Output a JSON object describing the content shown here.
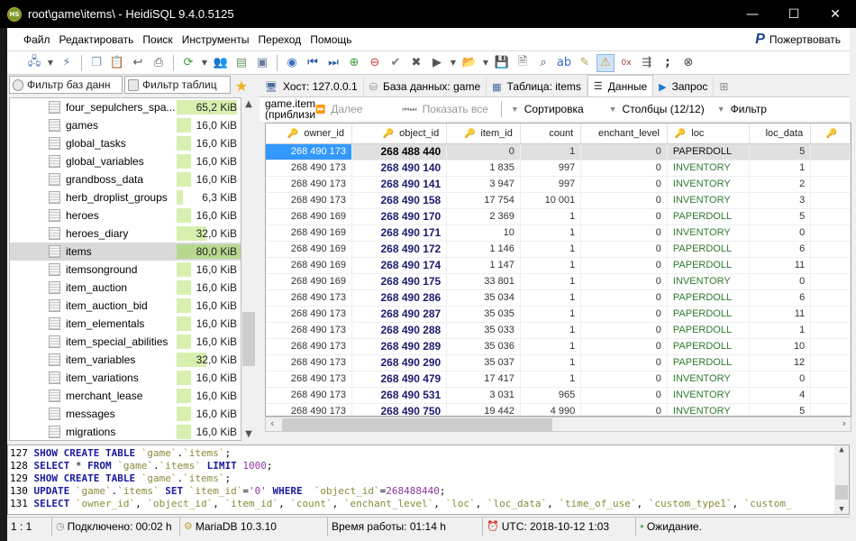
{
  "window": {
    "title": "root\\game\\items\\ - HeidiSQL 9.4.0.5125",
    "app_icon_label": "HS",
    "minimize": "—",
    "maximize": "☐",
    "close": "✕"
  },
  "menu": {
    "items": [
      "Файл",
      "Редактировать",
      "Поиск",
      "Инструменты",
      "Переход",
      "Помощь"
    ],
    "donate_label": "Пожертвовать"
  },
  "sidebar": {
    "filter_db_placeholder": "Фильтр баз данн",
    "filter_tables_placeholder": "Фильтр таблиц",
    "tables": [
      {
        "name": "four_sepulchers_spa...",
        "size": "65,2 KiB",
        "fill": 0.82
      },
      {
        "name": "games",
        "size": "16,0 KiB",
        "fill": 0.2
      },
      {
        "name": "global_tasks",
        "size": "16,0 KiB",
        "fill": 0.2
      },
      {
        "name": "global_variables",
        "size": "16,0 KiB",
        "fill": 0.2
      },
      {
        "name": "grandboss_data",
        "size": "16,0 KiB",
        "fill": 0.2
      },
      {
        "name": "herb_droplist_groups",
        "size": "6,3 KiB",
        "fill": 0.08
      },
      {
        "name": "heroes",
        "size": "16,0 KiB",
        "fill": 0.2
      },
      {
        "name": "heroes_diary",
        "size": "32,0 KiB",
        "fill": 0.4
      },
      {
        "name": "items",
        "size": "80,0 KiB",
        "fill": 1.0,
        "selected": true
      },
      {
        "name": "itemsonground",
        "size": "16,0 KiB",
        "fill": 0.2
      },
      {
        "name": "item_auction",
        "size": "16,0 KiB",
        "fill": 0.2
      },
      {
        "name": "item_auction_bid",
        "size": "16,0 KiB",
        "fill": 0.2
      },
      {
        "name": "item_elementals",
        "size": "16,0 KiB",
        "fill": 0.2
      },
      {
        "name": "item_special_abilities",
        "size": "16,0 KiB",
        "fill": 0.2
      },
      {
        "name": "item_variables",
        "size": "32,0 KiB",
        "fill": 0.4
      },
      {
        "name": "item_variations",
        "size": "16,0 KiB",
        "fill": 0.2
      },
      {
        "name": "merchant_lease",
        "size": "16,0 KiB",
        "fill": 0.2
      },
      {
        "name": "messages",
        "size": "16,0 KiB",
        "fill": 0.2
      },
      {
        "name": "migrations",
        "size": "16,0 KiB",
        "fill": 0.2
      }
    ]
  },
  "tabs": [
    {
      "label": "Хост: 127.0.0.1",
      "icon": "host-icon"
    },
    {
      "label": "База данных: game",
      "icon": "database-icon"
    },
    {
      "label": "Таблица: items",
      "icon": "table-icon"
    },
    {
      "label": "Данные",
      "icon": "data-icon",
      "active": true
    },
    {
      "label": "Запрос",
      "icon": "query-icon"
    }
  ],
  "data_toolbar": {
    "table_label": "game.item (приблизи",
    "next_label": "Далее",
    "show_all_label": "Показать все",
    "sort_label": "Сортировка",
    "columns_label": "Столбцы (12/12)",
    "filter_label": "Фильтр"
  },
  "grid": {
    "columns": [
      "owner_id",
      "object_id",
      "item_id",
      "count",
      "enchant_level",
      "loc",
      "loc_data",
      ""
    ],
    "rows": [
      [
        "268 490 173",
        "268 488 440",
        "0",
        "1",
        "0",
        "PAPERDOLL",
        "5"
      ],
      [
        "268 490 173",
        "268 490 140",
        "1 835",
        "997",
        "0",
        "INVENTORY",
        "1"
      ],
      [
        "268 490 173",
        "268 490 141",
        "3 947",
        "997",
        "0",
        "INVENTORY",
        "2"
      ],
      [
        "268 490 173",
        "268 490 158",
        "17 754",
        "10 001",
        "0",
        "INVENTORY",
        "3"
      ],
      [
        "268 490 169",
        "268 490 170",
        "2 369",
        "1",
        "0",
        "PAPERDOLL",
        "5"
      ],
      [
        "268 490 169",
        "268 490 171",
        "10",
        "1",
        "0",
        "INVENTORY",
        "0"
      ],
      [
        "268 490 169",
        "268 490 172",
        "1 146",
        "1",
        "0",
        "PAPERDOLL",
        "6"
      ],
      [
        "268 490 169",
        "268 490 174",
        "1 147",
        "1",
        "0",
        "PAPERDOLL",
        "11"
      ],
      [
        "268 490 169",
        "268 490 175",
        "33 801",
        "1",
        "0",
        "INVENTORY",
        "0"
      ],
      [
        "268 490 173",
        "268 490 286",
        "35 034",
        "1",
        "0",
        "PAPERDOLL",
        "6"
      ],
      [
        "268 490 173",
        "268 490 287",
        "35 035",
        "1",
        "0",
        "PAPERDOLL",
        "11"
      ],
      [
        "268 490 173",
        "268 490 288",
        "35 033",
        "1",
        "0",
        "PAPERDOLL",
        "1"
      ],
      [
        "268 490 173",
        "268 490 289",
        "35 036",
        "1",
        "0",
        "PAPERDOLL",
        "10"
      ],
      [
        "268 490 173",
        "268 490 290",
        "35 037",
        "1",
        "0",
        "PAPERDOLL",
        "12"
      ],
      [
        "268 490 173",
        "268 490 479",
        "17 417",
        "1",
        "0",
        "INVENTORY",
        "0"
      ],
      [
        "268 490 173",
        "268 490 531",
        "3 031",
        "965",
        "0",
        "INVENTORY",
        "4"
      ],
      [
        "268 490 173",
        "268 490 750",
        "19 442",
        "4 990",
        "0",
        "INVENTORY",
        "5"
      ]
    ]
  },
  "sql_log": [
    {
      "n": "127",
      "parts": [
        [
          "kw",
          "SHOW CREATE TABLE "
        ],
        [
          "id",
          "`game`"
        ],
        [
          "t",
          "."
        ],
        [
          "id",
          "`items`"
        ],
        [
          "t",
          ";"
        ]
      ]
    },
    {
      "n": "128",
      "parts": [
        [
          "kw",
          "SELECT "
        ],
        [
          "t",
          "* "
        ],
        [
          "kw",
          "FROM "
        ],
        [
          "id",
          "`game`"
        ],
        [
          "t",
          "."
        ],
        [
          "id",
          "`items`"
        ],
        [
          "kw",
          " LIMIT "
        ],
        [
          "num",
          "1000"
        ],
        [
          "t",
          ";"
        ]
      ]
    },
    {
      "n": "129",
      "parts": [
        [
          "kw",
          "SHOW CREATE TABLE "
        ],
        [
          "id",
          "`game`"
        ],
        [
          "t",
          "."
        ],
        [
          "id",
          "`items`"
        ],
        [
          "t",
          ";"
        ]
      ]
    },
    {
      "n": "130",
      "parts": [
        [
          "kw",
          "UPDATE "
        ],
        [
          "id",
          "`game`"
        ],
        [
          "t",
          "."
        ],
        [
          "id",
          "`items`"
        ],
        [
          "kw",
          " SET "
        ],
        [
          "id",
          "`item_id`"
        ],
        [
          "t",
          "="
        ],
        [
          "str",
          "'0'"
        ],
        [
          "kw",
          " WHERE  "
        ],
        [
          "id",
          "`object_id`"
        ],
        [
          "t",
          "="
        ],
        [
          "num",
          "268488440"
        ],
        [
          "t",
          ";"
        ]
      ]
    },
    {
      "n": "131",
      "parts": [
        [
          "kw",
          "SELECT "
        ],
        [
          "id",
          "`owner_id`"
        ],
        [
          "t",
          ", "
        ],
        [
          "id",
          "`object_id`"
        ],
        [
          "t",
          ", "
        ],
        [
          "id",
          "`item_id`"
        ],
        [
          "t",
          ", "
        ],
        [
          "id",
          "`count`"
        ],
        [
          "t",
          ", "
        ],
        [
          "id",
          "`enchant_level`"
        ],
        [
          "t",
          ", "
        ],
        [
          "id",
          "`loc`"
        ],
        [
          "t",
          ", "
        ],
        [
          "id",
          "`loc_data`"
        ],
        [
          "t",
          ", "
        ],
        [
          "id",
          "`time_of_use`"
        ],
        [
          "t",
          ", "
        ],
        [
          "id",
          "`custom_type1`"
        ],
        [
          "t",
          ", "
        ],
        [
          "id",
          "`custom_"
        ]
      ]
    }
  ],
  "status": {
    "position": "1 : 1",
    "connected": "Подключено: 00:02 h",
    "server": "MariaDB 10.3.10",
    "uptime": "Время работы: 01:14 h",
    "utc": "UTC: 2018-10-12 1:03",
    "state": "Ожидание."
  }
}
